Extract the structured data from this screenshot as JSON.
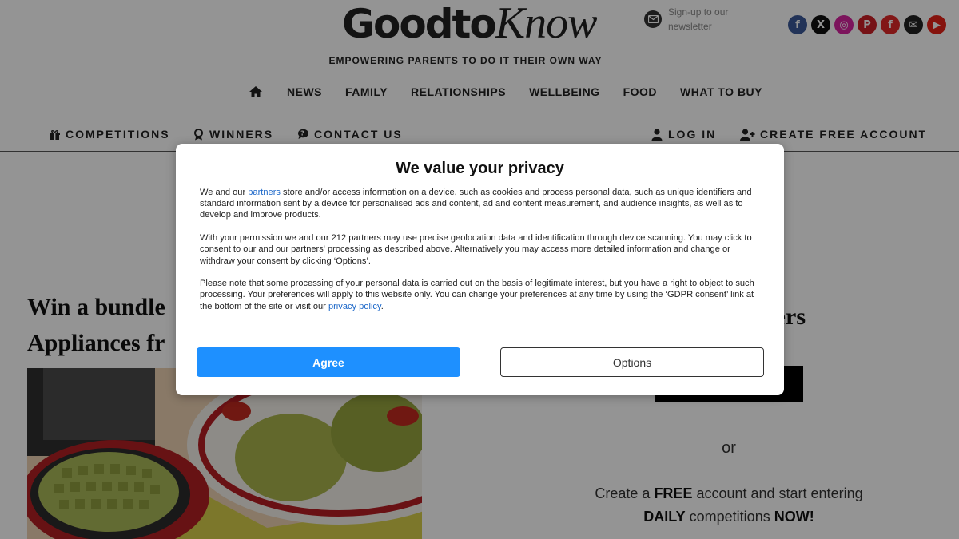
{
  "header": {
    "logo_part1": "Goodto",
    "logo_part2": "Know",
    "newsletter_text": "Sign-up to our newsletter",
    "tagline": "EMPOWERING PARENTS TO DO IT THEIR OWN WAY",
    "socials": [
      {
        "name": "facebook-icon",
        "glyph": "f",
        "color": "#3b5998"
      },
      {
        "name": "x-icon",
        "glyph": "X",
        "color": "#111111"
      },
      {
        "name": "instagram-icon",
        "glyph": "◎",
        "color": "#d6249f"
      },
      {
        "name": "pinterest-icon",
        "glyph": "P",
        "color": "#cb2027"
      },
      {
        "name": "flipboard-icon",
        "glyph": "f",
        "color": "#e12828"
      },
      {
        "name": "email-icon",
        "glyph": "✉",
        "color": "#222222"
      },
      {
        "name": "youtube-icon",
        "glyph": "▶",
        "color": "#e62117"
      }
    ]
  },
  "main_nav": {
    "items": [
      "NEWS",
      "FAMILY",
      "RELATIONSHIPS",
      "WELLBEING",
      "FOOD",
      "WHAT TO BUY"
    ]
  },
  "sub_nav": {
    "competitions": "COMPETITIONS",
    "winners": "WINNERS",
    "contact": "CONTACT US",
    "login": "LOG IN",
    "create_account": "CREATE FREE ACCOUNT"
  },
  "content": {
    "article_title_line1": "Win a bundle",
    "article_title_line2": "Appliances fr",
    "right_title_fragment": "bers",
    "or_text": "or",
    "signup": {
      "pre1": "Create a ",
      "bold1": "FREE",
      "post1": " account and start entering",
      "bold2": "DAILY",
      "mid2": " competitions ",
      "bold3": "NOW!"
    }
  },
  "consent": {
    "title": "We value your privacy",
    "p1_before": "We and our ",
    "p1_link": "partners",
    "p1_after": " store and/or access information on a device, such as cookies and process personal data, such as unique identifiers and standard information sent by a device for personalised ads and content, ad and content measurement, and audience insights, as well as to develop and improve products.",
    "p2": "With your permission we and our 212 partners may use precise geolocation data and identification through device scanning. You may click to consent to our and our partners' processing as described above. Alternatively you may access more detailed information and change or withdraw your consent by clicking ‘Options’.",
    "p3_before": "Please note that some processing of your personal data is carried out on the basis of legitimate interest, but you have a right to object to such processing. Your preferences will apply to this website only. You can change your preferences at any time by using the ‘GDPR consent’ link at the bottom of the site or visit our ",
    "p3_link": "privacy policy",
    "p3_after": ".",
    "agree_label": "Agree",
    "options_label": "Options"
  },
  "colors": {
    "agree_button": "#1e90ff",
    "link": "#1a66c8"
  }
}
